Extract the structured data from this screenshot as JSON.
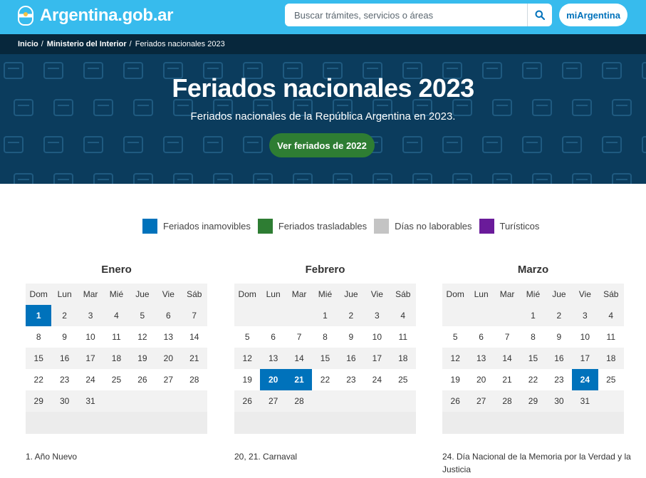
{
  "header": {
    "logo_text": "Argentina.gob.ar",
    "search_placeholder": "Buscar trámites, servicios o áreas",
    "login_label": "miArgentina",
    "colors": {
      "bar": "#37bbed"
    }
  },
  "breadcrumb": {
    "items": [
      "Inicio",
      "Ministerio del Interior",
      "Feriados nacionales 2023"
    ]
  },
  "hero": {
    "title": "Feriados nacionales 2023",
    "subtitle": "Feriados nacionales de la República Argentina en 2023.",
    "button_label": "Ver feriados de 2022",
    "colors": {
      "background": "#0b3c5d",
      "button": "#2e7d33"
    }
  },
  "legend": [
    {
      "label": "Feriados inamovibles",
      "color": "#0072bb"
    },
    {
      "label": "Feriados trasladables",
      "color": "#2e7d33"
    },
    {
      "label": "Días no laborables",
      "color": "#c4c4c4"
    },
    {
      "label": "Turísticos",
      "color": "#6a1b9a"
    }
  ],
  "weekdays": [
    "Dom",
    "Lun",
    "Mar",
    "Mié",
    "Jue",
    "Vie",
    "Sáb"
  ],
  "months": [
    {
      "name": "Enero",
      "weeks": [
        [
          "",
          "",
          "",
          "",
          "",
          "",
          ""
        ],
        [
          "1",
          "2",
          "3",
          "4",
          "5",
          "6",
          "7"
        ],
        [
          "8",
          "9",
          "10",
          "11",
          "12",
          "13",
          "14"
        ],
        [
          "15",
          "16",
          "17",
          "18",
          "19",
          "20",
          "21"
        ],
        [
          "22",
          "23",
          "24",
          "25",
          "26",
          "27",
          "28"
        ],
        [
          "29",
          "30",
          "31",
          "",
          "",
          "",
          ""
        ]
      ],
      "holidays": [
        "1"
      ],
      "note": "1. Año Nuevo"
    },
    {
      "name": "Febrero",
      "weeks": [
        [
          "",
          "",
          "",
          "1",
          "2",
          "3",
          "4"
        ],
        [
          "5",
          "6",
          "7",
          "8",
          "9",
          "10",
          "11"
        ],
        [
          "12",
          "13",
          "14",
          "15",
          "16",
          "17",
          "18"
        ],
        [
          "19",
          "20",
          "21",
          "22",
          "23",
          "24",
          "25"
        ],
        [
          "26",
          "27",
          "28",
          "",
          "",
          "",
          ""
        ]
      ],
      "holidays": [
        "20",
        "21"
      ],
      "note": "20, 21. Carnaval"
    },
    {
      "name": "Marzo",
      "weeks": [
        [
          "",
          "",
          "",
          "1",
          "2",
          "3",
          "4"
        ],
        [
          "5",
          "6",
          "7",
          "8",
          "9",
          "10",
          "11"
        ],
        [
          "12",
          "13",
          "14",
          "15",
          "16",
          "17",
          "18"
        ],
        [
          "19",
          "20",
          "21",
          "22",
          "23",
          "24",
          "25"
        ],
        [
          "26",
          "27",
          "28",
          "29",
          "30",
          "31",
          ""
        ]
      ],
      "holidays": [
        "24"
      ],
      "note": "24. Día Nacional de la Memoria por la Verdad y la Justicia"
    }
  ]
}
